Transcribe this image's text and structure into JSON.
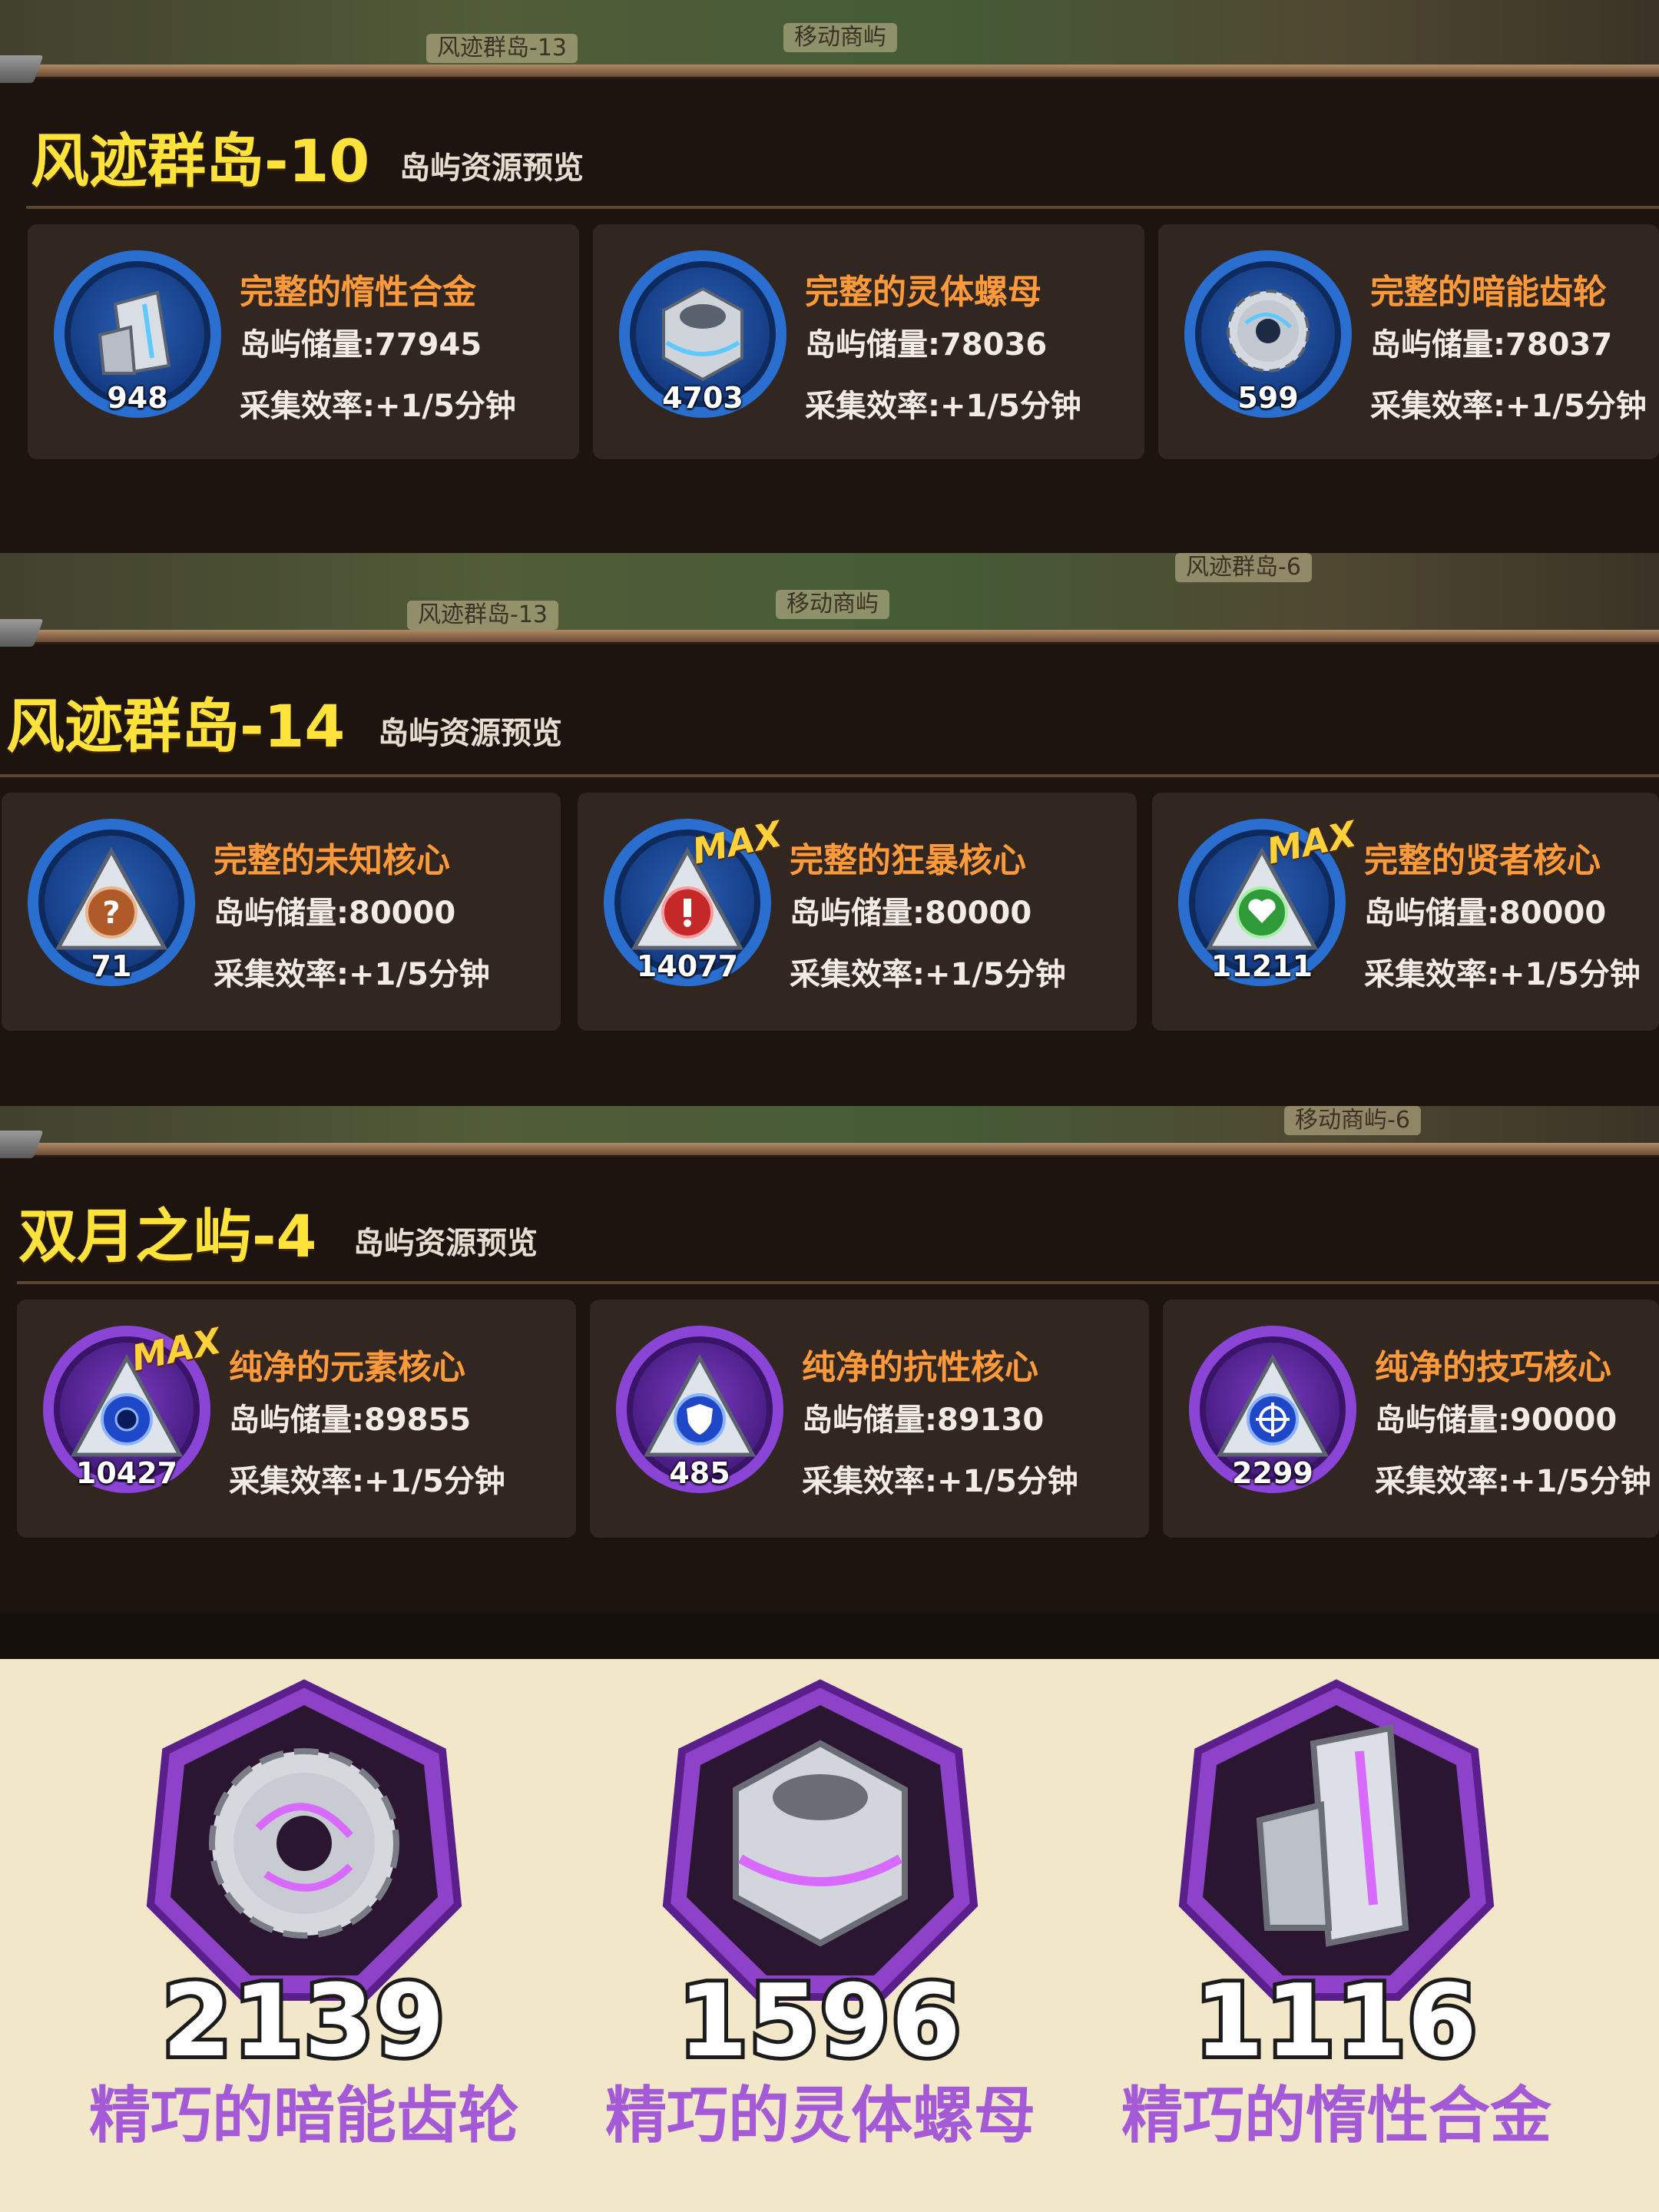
{
  "panels": [
    {
      "map_labels": [
        "风迹群岛-13",
        "移动商屿"
      ],
      "title": "风迹群岛-10",
      "subtitle": "岛屿资源预览",
      "cards": [
        {
          "name": "完整的惰性合金",
          "storage": "岛屿储量:77945",
          "rate": "采集效率:+1/5分钟",
          "count": "948",
          "icon": "alloy-icon",
          "max": ""
        },
        {
          "name": "完整的灵体螺母",
          "storage": "岛屿储量:78036",
          "rate": "采集效率:+1/5分钟",
          "count": "4703",
          "icon": "nut-icon",
          "max": ""
        },
        {
          "name": "完整的暗能齿轮",
          "storage": "岛屿储量:78037",
          "rate": "采集效率:+1/5分钟",
          "count": "599",
          "icon": "gear-icon",
          "max": ""
        }
      ]
    },
    {
      "map_labels": [
        "风迹群岛-13",
        "移动商屿",
        "风迹群岛-6"
      ],
      "title": "风迹群岛-14",
      "subtitle": "岛屿资源预览",
      "cards": [
        {
          "name": "完整的未知核心",
          "storage": "岛屿储量:80000",
          "rate": "采集效率:+1/5分钟",
          "count": "71",
          "icon": "unknown-core-icon",
          "max": ""
        },
        {
          "name": "完整的狂暴核心",
          "storage": "岛屿储量:80000",
          "rate": "采集效率:+1/5分钟",
          "count": "14077",
          "icon": "berserk-core-icon",
          "max": "MAX"
        },
        {
          "name": "完整的贤者核心",
          "storage": "岛屿储量:80000",
          "rate": "采集效率:+1/5分钟",
          "count": "11211",
          "icon": "sage-core-icon",
          "max": "MAX"
        }
      ]
    },
    {
      "map_labels": [
        "移动商屿-6"
      ],
      "title": "双月之屿-4",
      "subtitle": "岛屿资源预览",
      "cards": [
        {
          "name": "纯净的元素核心",
          "storage": "岛屿储量:89855",
          "rate": "采集效率:+1/5分钟",
          "count": "10427",
          "icon": "element-core-icon",
          "max": "MAX"
        },
        {
          "name": "纯净的抗性核心",
          "storage": "岛屿储量:89130",
          "rate": "采集效率:+1/5分钟",
          "count": "485",
          "icon": "resist-core-icon",
          "max": ""
        },
        {
          "name": "纯净的技巧核心",
          "storage": "岛屿储量:90000",
          "rate": "采集效率:+1/5分钟",
          "count": "2299",
          "icon": "skill-core-icon",
          "max": ""
        }
      ]
    }
  ],
  "inventory": [
    {
      "count": "2139",
      "name": "精巧的暗能齿轮",
      "icon": "gear-icon"
    },
    {
      "count": "1596",
      "name": "精巧的灵体螺母",
      "icon": "nut-icon"
    },
    {
      "count": "1116",
      "name": "精巧的惰性合金",
      "icon": "alloy-icon"
    }
  ],
  "colors": {
    "title": "#ffe23a",
    "resource_name": "#ff9a3a",
    "inventory_name": "#a45ad6",
    "card_bg": "#322620",
    "panel_bg": "#1d140f",
    "bottom_bg": "#f2e7c8"
  }
}
